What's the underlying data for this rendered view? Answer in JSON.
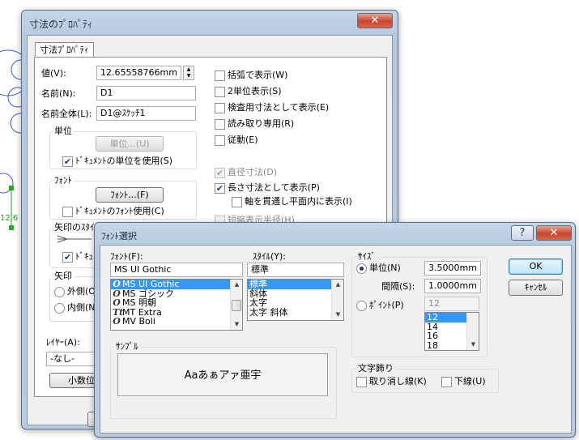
{
  "dim_dialog": {
    "title": "寸法のﾌﾟﾛﾊﾟﾃｨ",
    "tab": "寸法ﾌﾟﾛﾊﾟﾃｨ",
    "value_label": "値(V):",
    "value": "12.65558766mm",
    "name_label": "名前(N):",
    "name": "D1",
    "fullname_label": "名前全体(L):",
    "fullname": "D1@ｽｹｯﾁ1",
    "units_group": "単位",
    "units_button": "単位...(U)",
    "use_doc_units": "ﾄﾞｷｭﾒﾝﾄの単位を使用(S)",
    "font_group": "ﾌｫﾝﾄ",
    "font_button": "ﾌｫﾝﾄ...(F)",
    "use_doc_font": "ﾄﾞｷｭﾒﾝﾄのﾌｫﾝﾄ使用(C)",
    "arrow_style_group": "矢印のｽﾀｲﾙ",
    "doc_partial": "ﾄﾞｷｭ",
    "arrow_group": "矢印",
    "outside": "外側(O",
    "inside": "内側(N",
    "layer_label": "ﾚｲﾔｰ(A):",
    "layer_value": "-なし-",
    "decimals_button": "小数位数",
    "chk_paren": "括弧で表示(W)",
    "chk_dual": "2単位表示(S)",
    "chk_inspect": "検査用寸法として表示(E)",
    "chk_readonly": "読み取り専用(R)",
    "chk_driven": "従動(E)",
    "chk_diameter": "直径寸法(D)",
    "chk_length": "長さ寸法として表示(P)",
    "chk_axis": "軸を貫通し平面内に表示(I)",
    "chk_short_radius": "短縮表示半径(H)",
    "sketch_label": "12.6"
  },
  "font_dialog": {
    "title": "ﾌｫﾝﾄ選択",
    "help_btn": "?",
    "close_btn": "✕",
    "font_label": "ﾌｫﾝﾄ(F):",
    "font_value": "MS UI Gothic",
    "fonts": [
      "MS UI Gothic",
      "MS ゴシック",
      "MS 明朝",
      "MT Extra",
      "MV Boli"
    ],
    "font_icons": [
      "O",
      "O",
      "O",
      "Tt",
      "O"
    ],
    "style_label": "ｽﾀｲﾙ(Y):",
    "style_value": "標準",
    "styles": [
      "標準",
      "斜体",
      "太字",
      "太字 斜体"
    ],
    "size_group": "ｻｲｽﾞ",
    "unit_label": "単位(N)",
    "unit_value": "3.5000mm",
    "spacing_label": "間隔(S):",
    "spacing_value": "1.0000mm",
    "point_label": "ﾎﾟｲﾝﾄ(P)",
    "point_value": "12",
    "points": [
      "12",
      "14",
      "16",
      "18"
    ],
    "sample_group": "ｻﾝﾌﾟﾙ",
    "sample_text": "Aaあぁアァ亜宇",
    "effects_group": "文字飾り",
    "strike_label": "取り消し線(K)",
    "underline_label": "下線(U)",
    "ok": "OK",
    "cancel": "ｷｬﾝｾﾙ"
  },
  "colors": {
    "selection": "#3399ff",
    "sketch_blue": "#2255cc",
    "sketch_green": "#22aa22"
  }
}
